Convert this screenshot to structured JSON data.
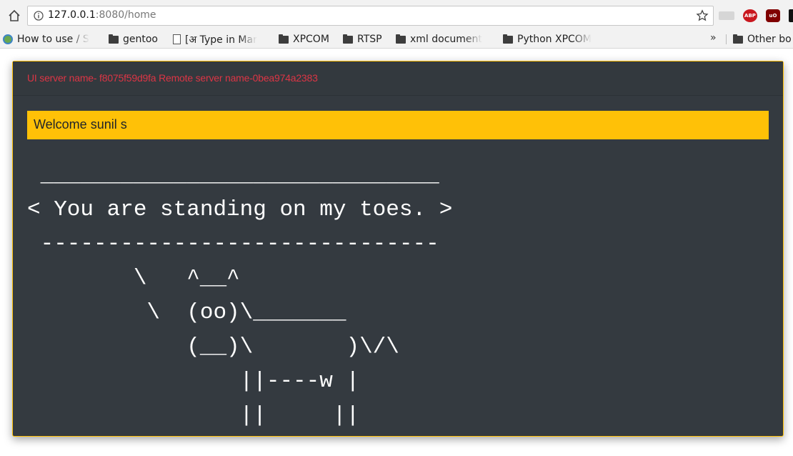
{
  "browser": {
    "url_host": "127.0.0.1",
    "url_rest": ":8080/home",
    "extensions": [
      {
        "icon": "pdf-extension-icon",
        "label": ""
      },
      {
        "icon": "adblock-plus-icon",
        "label": "ABP"
      },
      {
        "icon": "ublock-origin-icon",
        "label": "uO"
      },
      {
        "icon": "extension-icon",
        "label": ""
      }
    ],
    "bookmarks": [
      {
        "label": "How to use / S",
        "icon": "site-favicon-icon"
      },
      {
        "label": "gentoo",
        "icon": "folder-icon"
      },
      {
        "label": "[अ Type in Mar",
        "icon": "page-icon"
      },
      {
        "label": "XPCOM",
        "icon": "folder-icon"
      },
      {
        "label": "RTSP",
        "icon": "folder-icon"
      },
      {
        "label": "xml document",
        "icon": "folder-icon"
      },
      {
        "label": "Python XPCOM",
        "icon": "folder-icon"
      }
    ],
    "overflow_label": "»",
    "other_bookmarks_label": "Other bo"
  },
  "page": {
    "server_info": "UI server name- f8075f59d9fa Remote server name-0bea974a2383",
    "welcome": "Welcome sunil s",
    "cowsay": " ______________________________\n< You are standing on my toes. >\n ------------------------------\n        \\   ^__^\n         \\  (oo)\\_______\n            (__)\\       )\\/\\\n                ||----w |\n                ||     ||"
  },
  "colors": {
    "card_bg": "#343a40",
    "accent": "#ffc107",
    "danger": "#dc3545"
  }
}
